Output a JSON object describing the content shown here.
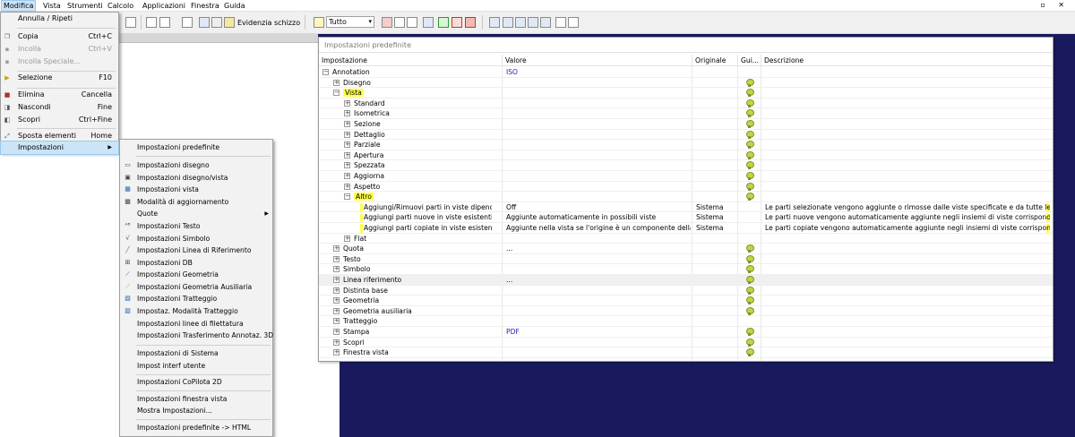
{
  "menubar": {
    "items": [
      "Modifica",
      "Vista",
      "Strumenti",
      "Calcolo",
      "Applicazioni",
      "Finestra",
      "Guida"
    ],
    "window_controls": "▫ ✕"
  },
  "toolbar": {
    "evidenzia_label": "Evidenzia schizzo",
    "filter_value": "Tutto"
  },
  "menu_modifica": {
    "items": [
      {
        "label": "Annulla / Ripeti",
        "shortcut": "",
        "icon": "undo-icon",
        "state": "normal"
      },
      {
        "label": "Copia",
        "shortcut": "Ctrl+C",
        "icon": "copy-icon",
        "state": "normal"
      },
      {
        "label": "Incolla",
        "shortcut": "Ctrl+V",
        "icon": "paste-icon",
        "state": "disabled"
      },
      {
        "label": "Incolla Speciale...",
        "shortcut": "",
        "icon": "paste-special-icon",
        "state": "disabled"
      },
      {
        "label": "Selezione",
        "shortcut": "F10",
        "icon": "select-icon",
        "state": "normal"
      },
      {
        "label": "Elimina",
        "shortcut": "Cancella",
        "icon": "delete-icon",
        "state": "normal"
      },
      {
        "label": "Nascondi",
        "shortcut": "Fine",
        "icon": "hide-icon",
        "state": "normal"
      },
      {
        "label": "Scopri",
        "shortcut": "Ctrl+Fine",
        "icon": "unhide-icon",
        "state": "normal"
      },
      {
        "label": "Sposta elementi",
        "shortcut": "Home",
        "icon": "move-icon",
        "state": "normal"
      },
      {
        "label": "Impostazioni",
        "shortcut": "",
        "icon": "",
        "state": "highlighted"
      }
    ]
  },
  "submenu_impostazioni": {
    "items": [
      "Impostazioni predefinite",
      "Impostazioni disegno",
      "Impostazioni disegno/vista",
      "Impostazioni vista",
      "Modalità di aggiornamento",
      "Quote",
      "Impostazioni Testo",
      "Impostazioni Simbolo",
      "Impostazioni Linea di Riferimento",
      "Impostazioni DB",
      "Impostazioni Geometria",
      "Impostazioni Geometria Ausiliaria",
      "Impostazioni Tratteggio",
      "Impostaz. Modalità Tratteggio",
      "Impostazioni linee di filettatura",
      "Impostazioni Trasferimento Annotaz. 3D",
      "Impostazioni di Sistema",
      "Impost interf utente",
      "Impostazioni CoPilota 2D",
      "Impostazioni finestra vista",
      "Mostra Impostazioni...",
      "Impostazioni predefinite -> HTML"
    ]
  },
  "dialog": {
    "title": "Impostazioni predefinite",
    "columns": [
      "Impostazione",
      "Valore",
      "Originale",
      "Gui...",
      "Descrizione"
    ],
    "rows": [
      {
        "name": "Annotation",
        "value": "ISO",
        "original": "",
        "desc": "",
        "level": 0,
        "expander": "−"
      },
      {
        "name": "Disegno",
        "value": "",
        "original": "",
        "desc": "",
        "level": 1,
        "expander": "+"
      },
      {
        "name": "Vista",
        "value": "",
        "original": "",
        "desc": "",
        "level": 1,
        "expander": "−"
      },
      {
        "name": "Standard",
        "value": "",
        "original": "",
        "desc": "",
        "level": 2,
        "expander": "+"
      },
      {
        "name": "Isometrica",
        "value": "",
        "original": "",
        "desc": "",
        "level": 2,
        "expander": "+"
      },
      {
        "name": "Sezione",
        "value": "",
        "original": "",
        "desc": "",
        "level": 2,
        "expander": "+"
      },
      {
        "name": "Dettaglio",
        "value": "",
        "original": "",
        "desc": "",
        "level": 2,
        "expander": "+"
      },
      {
        "name": "Parziale",
        "value": "",
        "original": "",
        "desc": "",
        "level": 2,
        "expander": "+"
      },
      {
        "name": "Apertura",
        "value": "",
        "original": "",
        "desc": "",
        "level": 2,
        "expander": "+"
      },
      {
        "name": "Spezzata",
        "value": "",
        "original": "",
        "desc": "",
        "level": 2,
        "expander": "+"
      },
      {
        "name": "Aggiorna",
        "value": "",
        "original": "",
        "desc": "",
        "level": 2,
        "expander": "+"
      },
      {
        "name": "Aspetto",
        "value": "",
        "original": "",
        "desc": "",
        "level": 2,
        "expander": "+"
      },
      {
        "name": "Altro",
        "value": "",
        "original": "",
        "desc": "",
        "level": 2,
        "expander": "−"
      },
      {
        "name": "Aggiungi/Rimuovi parti in viste dipendenti",
        "value": "Off",
        "original": "Sistema",
        "desc": "Le parti selezionate vengono aggiunte o rimosse dalle viste specificate e da tutte le viste dipendenti.",
        "level": 3,
        "expander": ""
      },
      {
        "name": "Aggiungi parti nuove in viste esistenti",
        "value": "Aggiunte automaticamente in possibili viste",
        "original": "Sistema",
        "desc": "Le parti nuove vengono automaticamente aggiunte negli insiemi di viste corrispondenti.",
        "level": 3,
        "expander": ""
      },
      {
        "name": "Aggiungi parti copiate in viste esistenti",
        "value": "Aggiunte nella vista se l'origine è un componente della vista",
        "original": "Sistema",
        "desc": "Le parti copiate vengono automaticamente aggiunte negli insiemi di viste corrispondenti.",
        "level": 3,
        "expander": ""
      },
      {
        "name": "Flat",
        "value": "",
        "original": "",
        "desc": "",
        "level": 2,
        "expander": "+"
      },
      {
        "name": "Quota",
        "value": "...",
        "original": "",
        "desc": "",
        "level": 1,
        "expander": "+"
      },
      {
        "name": "Testo",
        "value": "",
        "original": "",
        "desc": "",
        "level": 1,
        "expander": "+"
      },
      {
        "name": "Simbolo",
        "value": "",
        "original": "",
        "desc": "",
        "level": 1,
        "expander": "+"
      },
      {
        "name": "Linea riferimento",
        "value": "...",
        "original": "",
        "desc": "",
        "level": 1,
        "expander": "+"
      },
      {
        "name": "Distinta base",
        "value": "",
        "original": "",
        "desc": "",
        "level": 1,
        "expander": "+"
      },
      {
        "name": "Geometria",
        "value": "",
        "original": "",
        "desc": "",
        "level": 1,
        "expander": "+"
      },
      {
        "name": "Geometria ausiliaria",
        "value": "",
        "original": "",
        "desc": "",
        "level": 1,
        "expander": "+"
      },
      {
        "name": "Tratteggio",
        "value": "",
        "original": "",
        "desc": "",
        "level": 1,
        "expander": "+"
      },
      {
        "name": "Stampa",
        "value": "PDF",
        "original": "",
        "desc": "",
        "level": 1,
        "expander": "+"
      },
      {
        "name": "Scopri",
        "value": "",
        "original": "",
        "desc": "",
        "level": 1,
        "expander": "+"
      },
      {
        "name": "Finestra vista",
        "value": "",
        "original": "",
        "desc": "",
        "level": 1,
        "expander": "+"
      }
    ]
  }
}
